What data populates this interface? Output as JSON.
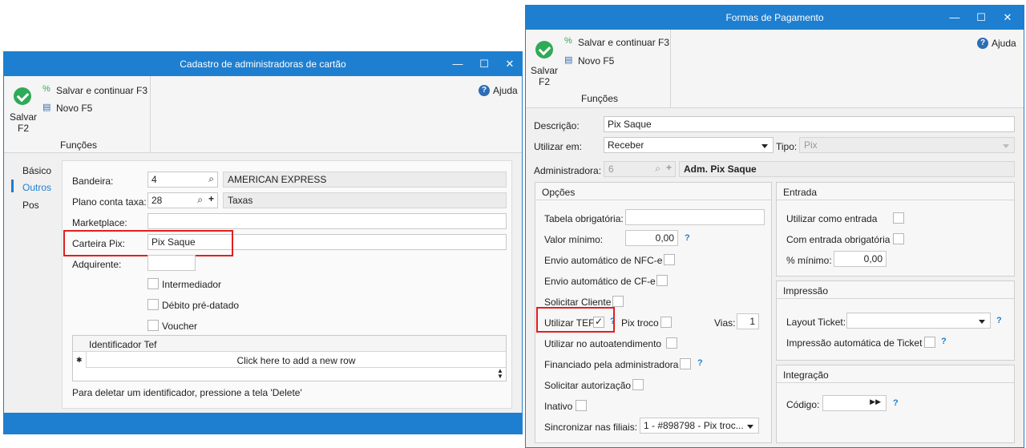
{
  "left_window": {
    "title": "Cadastro de administradoras de cartão",
    "controls": {
      "minimize": "—",
      "maximize": "☐",
      "close": "✕"
    },
    "ribbon": {
      "save_line1": "Salvar",
      "save_line2": "F2",
      "save_continue": "Salvar e continuar F3",
      "new": "Novo F5",
      "group_label": "Funções",
      "help": "Ajuda"
    },
    "nav": [
      "Básico",
      "Outros",
      "Pos"
    ],
    "nav_selected": "Outros",
    "form": {
      "bandeira_label": "Bandeira:",
      "bandeira_code": "4",
      "bandeira_name": "AMERICAN EXPRESS",
      "plano_label": "Plano conta taxa:",
      "plano_code": "28",
      "plano_name": "Taxas",
      "marketplace_label": "Marketplace:",
      "marketplace_value": "",
      "carteira_label": "Carteira Pix:",
      "carteira_value": "Pix Saque",
      "adquirente_label": "Adquirente:",
      "adquirente_value": "",
      "intermediador": "Intermediador",
      "debito": "Débito pré-datado",
      "voucher": "Voucher"
    },
    "grid": {
      "column": "Identificador Tef",
      "new_row": "Click here to add a new row",
      "row_marker": "✱"
    },
    "footer_note": "Para deletar um identificador, pressione a tela 'Delete'"
  },
  "right_window": {
    "title": "Formas de Pagamento",
    "controls": {
      "minimize": "—",
      "maximize": "☐",
      "close": "✕"
    },
    "ribbon": {
      "save_line1": "Salvar",
      "save_line2": "F2",
      "save_continue": "Salvar e continuar F3",
      "new": "Novo F5",
      "group_label": "Funções",
      "help": "Ajuda"
    },
    "descricao_label": "Descrição:",
    "descricao_value": "Pix Saque",
    "utilizar_label": "Utilizar em:",
    "utilizar_value": "Receber",
    "tipo_label": "Tipo:",
    "tipo_value": "Pix",
    "adm_label": "Administradora:",
    "adm_code": "6",
    "adm_name": "Adm. Pix Saque",
    "opcoes": {
      "title": "Opções",
      "tabela": "Tabela obrigatória:",
      "valor_min": "Valor mínimo:",
      "valor_min_value": "0,00",
      "nfce": "Envio automático de NFC-e",
      "cfe": "Envio automático de CF-e",
      "solicitar_cliente": "Solicitar Cliente",
      "utilizar_tef": "Utilizar TEF",
      "pix_troco": "Pix troco",
      "vias_label": "Vias:",
      "vias_value": "1",
      "autoatendimento": "Utilizar no autoatendimento",
      "financiado": "Financiado pela administradora",
      "solicitar_aut": "Solicitar autorização",
      "inativo": "Inativo",
      "sincronizar": "Sincronizar nas filiais:",
      "sincronizar_value": "1 - #898798 - Pix troc..."
    },
    "entrada": {
      "title": "Entrada",
      "utilizar_entrada": "Utilizar como entrada",
      "com_entrada": "Com entrada obrigatória",
      "pct_min": "% mínimo:",
      "pct_min_value": "0,00"
    },
    "impressao": {
      "title": "Impressão",
      "layout": "Layout Ticket:",
      "layout_value": "",
      "auto": "Impressão automática de Ticket"
    },
    "integracao": {
      "title": "Integração",
      "codigo": "Código:",
      "codigo_value": ""
    },
    "help_mark": "?"
  },
  "colors": {
    "titlebar": "#1e7fd0",
    "save_green": "#2faa58",
    "highlight_red": "#e02020"
  }
}
